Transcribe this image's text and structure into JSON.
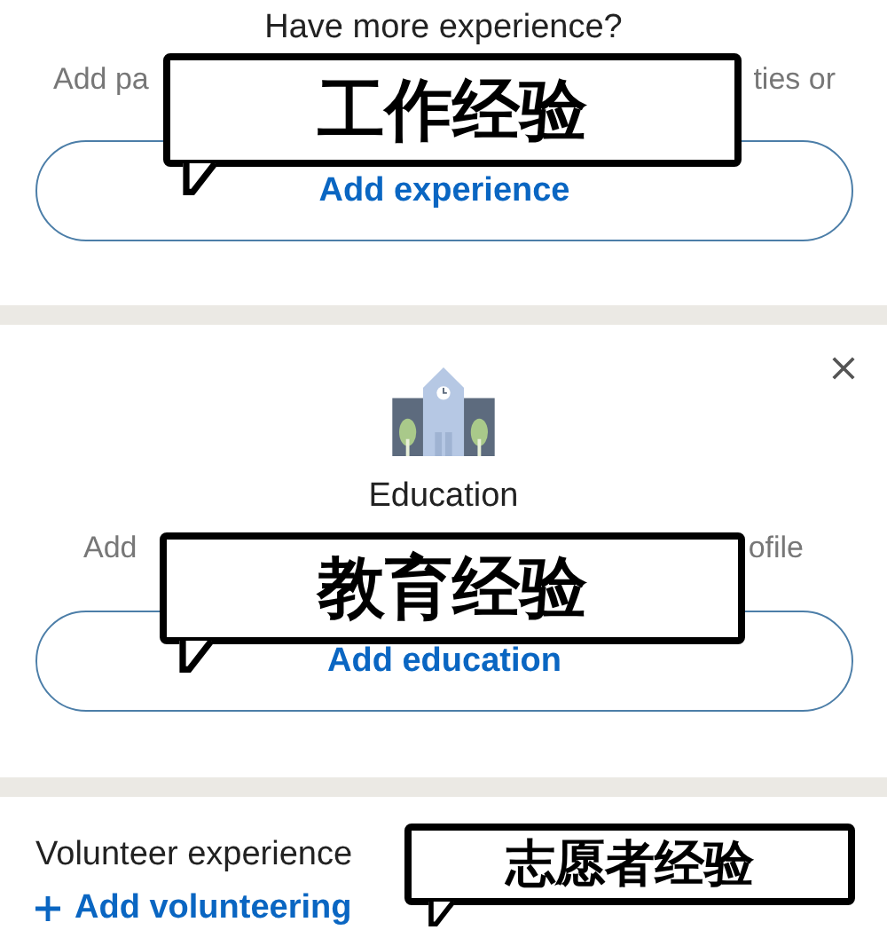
{
  "sections": [
    {
      "kind": "prompt",
      "title": "Have more experience?",
      "description_left": "Add pa",
      "description_right": "ties or",
      "button": "Add experience",
      "callout": "工作经验"
    },
    {
      "kind": "card",
      "title": "Education",
      "description_left": "Add",
      "description_right": "ofile",
      "button": "Add education",
      "callout": "教育经验"
    },
    {
      "kind": "row",
      "title": "Volunteer experience",
      "action": "Add volunteering",
      "callout": "志愿者经验"
    }
  ]
}
